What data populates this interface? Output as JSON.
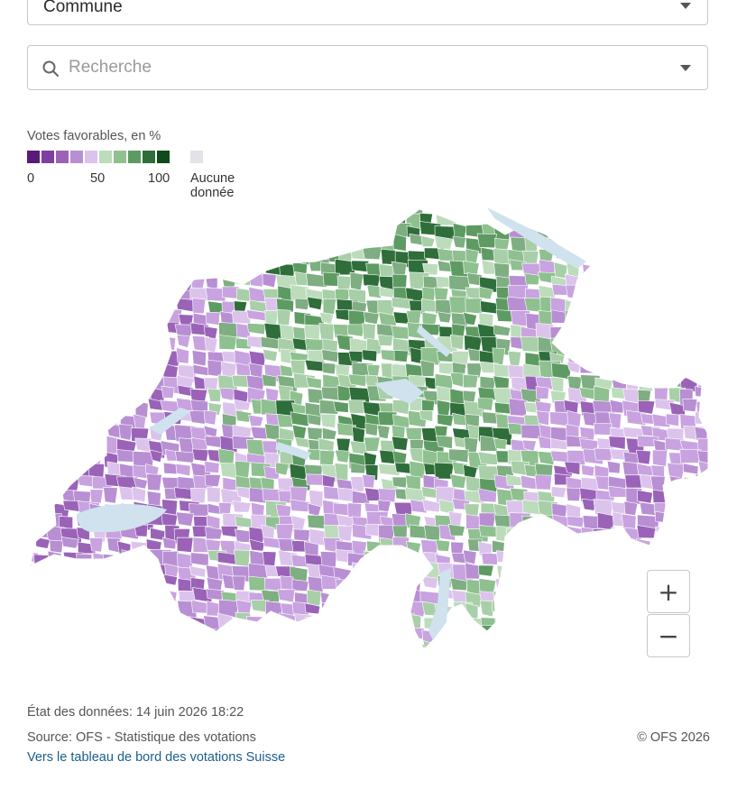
{
  "level_select": {
    "value": "Commune"
  },
  "search": {
    "placeholder": "Recherche"
  },
  "legend": {
    "title": "Votes favorables, en %",
    "colors": [
      "#5b1a7a",
      "#7e3fa0",
      "#9a63b8",
      "#b88fd3",
      "#dcc3ec",
      "#bcdcbc",
      "#8fc090",
      "#5e9b63",
      "#2f6e3a",
      "#0f4a1c"
    ],
    "no_data_color": "#e2e2e8",
    "tick_0": "0",
    "tick_50": "50",
    "tick_100": "100",
    "no_data_label": "Aucune donnée"
  },
  "map": {
    "lake_color": "#cfe2ee",
    "fill_colors": [
      "#b88fd3",
      "#dcc3ec",
      "#bcdcbc",
      "#8fc090",
      "#5e9b63",
      "#2f6e3a",
      "#9a63b8",
      "#c8a3e0",
      "#a8cfa8",
      "#7eae82"
    ]
  },
  "zoom": {
    "in_label": "+",
    "out_label": "−"
  },
  "footer": {
    "date": "État des données: 14 juin 2026 18:22",
    "source": "Source: OFS - Statistique des votations",
    "copyright": "© OFS 2026",
    "link": "Vers le tableau de bord des votations Suisse"
  }
}
